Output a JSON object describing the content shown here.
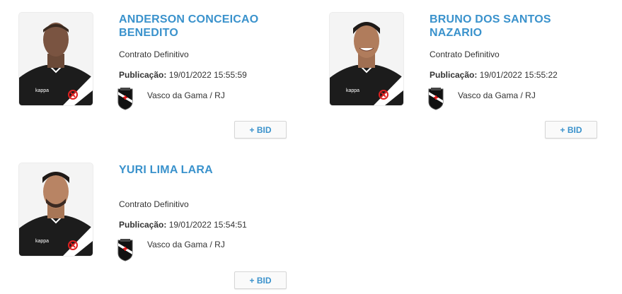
{
  "colors": {
    "accent": "#3a92cc",
    "text": "#333333"
  },
  "players": [
    {
      "name": "ANDERSON CONCEICAO BENEDITO",
      "contract": "Contrato Definitivo",
      "pub_label": "Publicação:",
      "pub_value": "19/01/2022 15:55:59",
      "club": "Vasco da Gama / RJ",
      "bid_label": "+ BID",
      "photo_icon": "player-photo-icon",
      "club_icon": "vasco-crest-icon"
    },
    {
      "name": "BRUNO DOS SANTOS NAZARIO",
      "contract": "Contrato Definitivo",
      "pub_label": "Publicação:",
      "pub_value": "19/01/2022 15:55:22",
      "club": "Vasco da Gama / RJ",
      "bid_label": "+ BID",
      "photo_icon": "player-photo-icon",
      "club_icon": "vasco-crest-icon"
    },
    {
      "name": "YURI LIMA LARA",
      "contract": "Contrato Definitivo",
      "pub_label": "Publicação:",
      "pub_value": "19/01/2022 15:54:51",
      "club": "Vasco da Gama / RJ",
      "bid_label": "+ BID",
      "photo_icon": "player-photo-icon",
      "club_icon": "vasco-crest-icon"
    }
  ]
}
